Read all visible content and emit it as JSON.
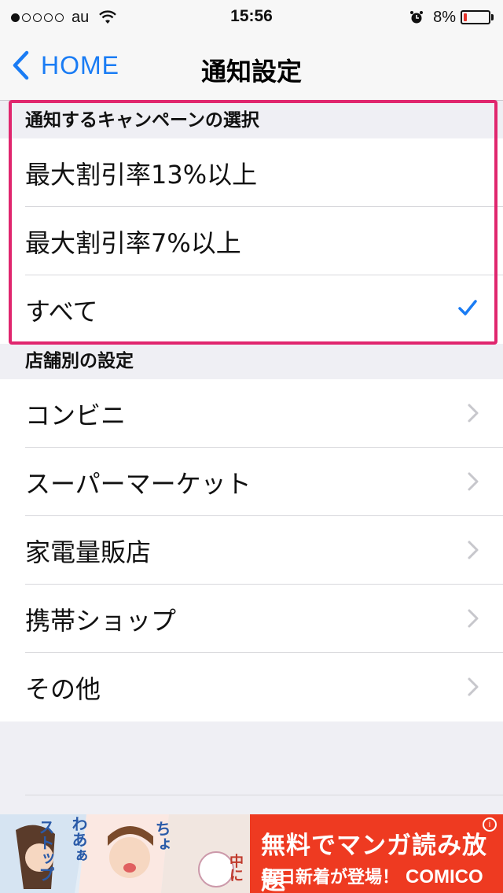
{
  "status_bar": {
    "carrier": "au",
    "time": "15:56",
    "battery": "8%",
    "signal_dots": [
      true,
      false,
      false,
      false,
      false
    ]
  },
  "nav": {
    "back_label": "HOME",
    "title": "通知設定"
  },
  "campaign_section": {
    "header": "通知するキャンペーンの選択",
    "options": [
      {
        "label": "最大割引率13%以上",
        "selected": false
      },
      {
        "label": "最大割引率7%以上",
        "selected": false
      },
      {
        "label": "すべて",
        "selected": true
      }
    ]
  },
  "store_section": {
    "header": "店舗別の設定",
    "items": [
      {
        "label": "コンビニ"
      },
      {
        "label": "スーパーマーケット"
      },
      {
        "label": "家電量販店"
      },
      {
        "label": "携帯ショップ"
      },
      {
        "label": "その他"
      }
    ]
  },
  "ad": {
    "main_text": "無料でマンガ読み放題",
    "sub_text": "毎日新着が登場！",
    "brand": "COMICO",
    "info": "i",
    "bubbles": [
      "ストップ",
      "わあぁ",
      "ちょ",
      "中に"
    ],
    "background_color": "#ee3a21"
  },
  "colors": {
    "accent": "#1a7cf4",
    "highlight_border": "#e0266e"
  }
}
